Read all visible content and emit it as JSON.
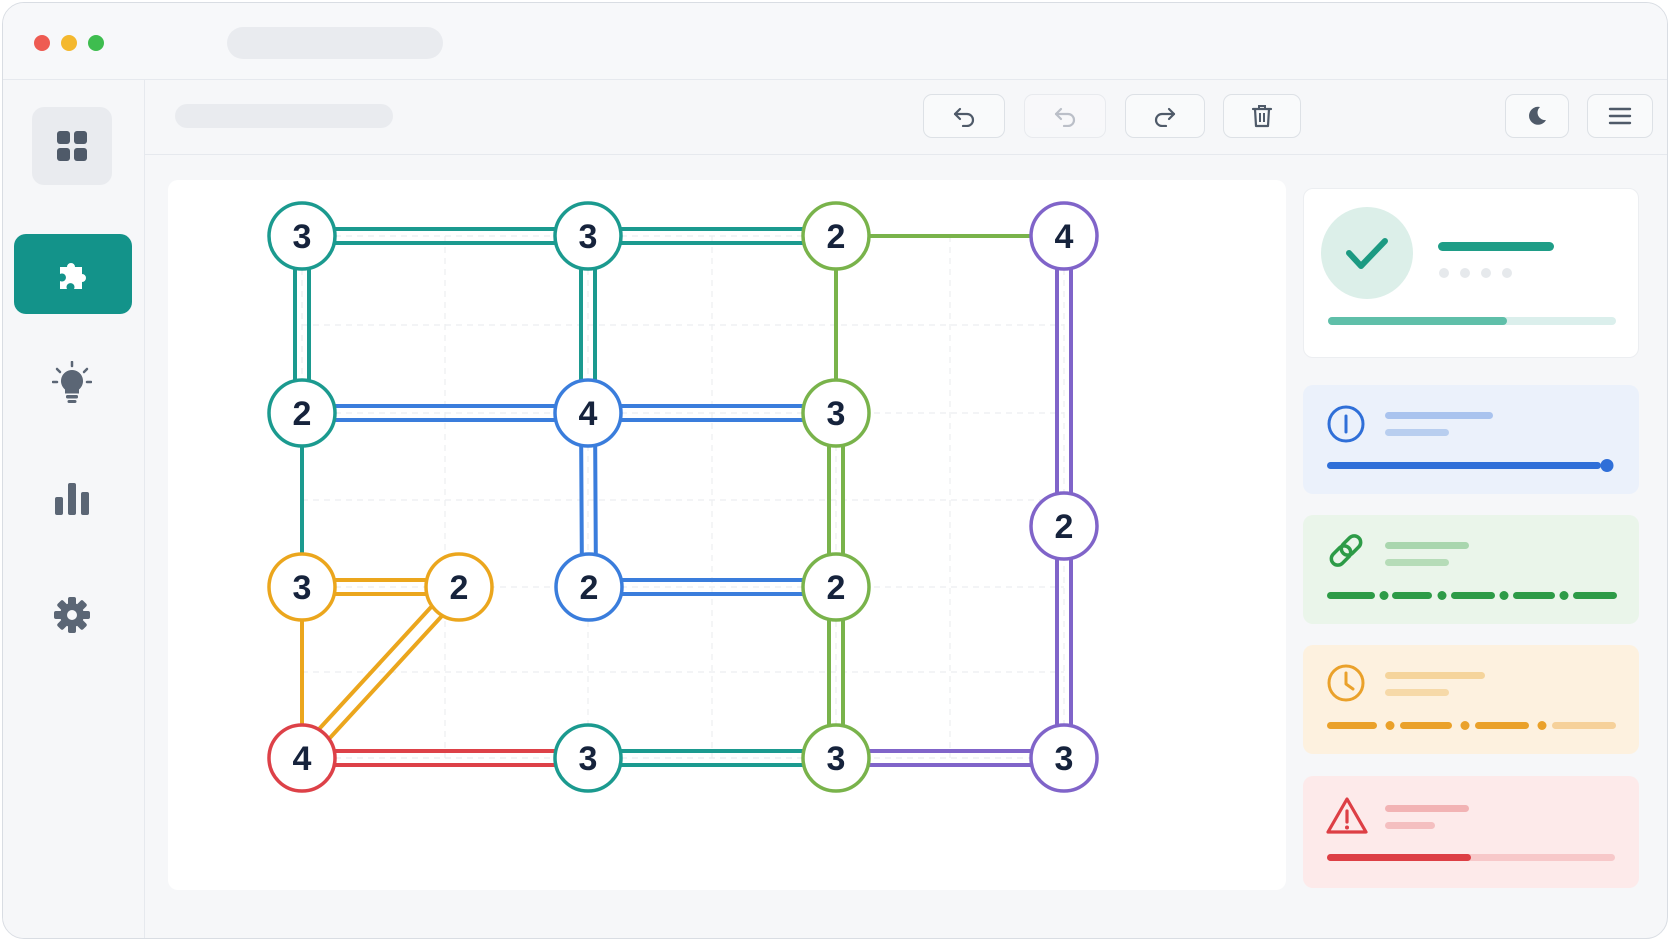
{
  "colors": {
    "accent": "#13938a",
    "teal": "#1b9a8f",
    "green": "#79b34b",
    "purple": "#8064c9",
    "blue": "#3a7ddc",
    "orange": "#eba61d",
    "red": "#dd4148",
    "success": "#2aa084",
    "info": "#2f6fd8",
    "link": "#2d9b47",
    "warning": "#eaa12a",
    "danger": "#dd3f45"
  },
  "sidebar": {
    "items": [
      {
        "name": "dashboard",
        "icon": "grid-icon",
        "active": false
      },
      {
        "name": "puzzle",
        "icon": "puzzle-icon",
        "active": true
      },
      {
        "name": "hints",
        "icon": "lightbulb-icon",
        "active": false
      },
      {
        "name": "stats",
        "icon": "bar-chart-icon",
        "active": false
      },
      {
        "name": "settings",
        "icon": "gear-icon",
        "active": false
      }
    ]
  },
  "toolbar": {
    "buttons": [
      {
        "name": "undo",
        "icon": "undo-icon",
        "enabled": true
      },
      {
        "name": "undo-secondary",
        "icon": "undo-icon",
        "enabled": false
      },
      {
        "name": "redo",
        "icon": "redo-icon",
        "enabled": true
      },
      {
        "name": "delete",
        "icon": "trash-icon",
        "enabled": true
      }
    ],
    "right_buttons": [
      {
        "name": "theme",
        "icon": "moon-icon"
      },
      {
        "name": "menu",
        "icon": "hamburger-icon"
      }
    ]
  },
  "puzzle": {
    "type": "hashi",
    "islands": [
      {
        "id": "r1c1",
        "value": "3",
        "color": "teal"
      },
      {
        "id": "r1c2",
        "value": "3",
        "color": "teal"
      },
      {
        "id": "r1c3",
        "value": "2",
        "color": "green"
      },
      {
        "id": "r1c4",
        "value": "4",
        "color": "purple"
      },
      {
        "id": "r2c1",
        "value": "2",
        "color": "teal"
      },
      {
        "id": "r2c2",
        "value": "4",
        "color": "blue"
      },
      {
        "id": "r2c3",
        "value": "3",
        "color": "green"
      },
      {
        "id": "r2c4",
        "value": "2",
        "color": "purple"
      },
      {
        "id": "r3c1",
        "value": "3",
        "color": "orange"
      },
      {
        "id": "r3c1b",
        "value": "2",
        "color": "orange"
      },
      {
        "id": "r3c2",
        "value": "2",
        "color": "blue"
      },
      {
        "id": "r3c3",
        "value": "2",
        "color": "green"
      },
      {
        "id": "r4c1",
        "value": "4",
        "color": "red"
      },
      {
        "id": "r4c2",
        "value": "3",
        "color": "teal"
      },
      {
        "id": "r4c3",
        "value": "3",
        "color": "green"
      },
      {
        "id": "r4c4",
        "value": "3",
        "color": "purple"
      }
    ],
    "bridges": [
      {
        "from": "r1c1",
        "to": "r1c2",
        "count": 2,
        "color": "teal"
      },
      {
        "from": "r1c2",
        "to": "r1c3",
        "count": 2,
        "color": "teal"
      },
      {
        "from": "r1c3",
        "to": "r1c4",
        "count": 1,
        "color": "green"
      },
      {
        "from": "r1c1",
        "to": "r2c1",
        "count": 2,
        "color": "teal"
      },
      {
        "from": "r1c2",
        "to": "r2c2",
        "count": 2,
        "color": "teal"
      },
      {
        "from": "r1c3",
        "to": "r2c3",
        "count": 1,
        "color": "green"
      },
      {
        "from": "r1c4",
        "to": "r2c4",
        "count": 2,
        "color": "purple"
      },
      {
        "from": "r2c1",
        "to": "r2c2",
        "count": 2,
        "color": "blue"
      },
      {
        "from": "r2c2",
        "to": "r2c3",
        "count": 2,
        "color": "blue"
      },
      {
        "from": "r2c1",
        "to": "r3c1",
        "count": 1,
        "color": "teal"
      },
      {
        "from": "r2c2",
        "to": "r3c2",
        "count": 2,
        "color": "blue"
      },
      {
        "from": "r2c3",
        "to": "r3c3",
        "count": 2,
        "color": "green"
      },
      {
        "from": "r2c4",
        "to": "r4c4",
        "count": 2,
        "color": "purple"
      },
      {
        "from": "r3c1",
        "to": "r3c1b",
        "count": 2,
        "color": "orange"
      },
      {
        "from": "r3c2",
        "to": "r3c3",
        "count": 2,
        "color": "blue"
      },
      {
        "from": "r3c1",
        "to": "r4c1",
        "count": 1,
        "color": "orange"
      },
      {
        "from": "r3c1b",
        "to": "r4c1",
        "count": 2,
        "color": "orange"
      },
      {
        "from": "r3c3",
        "to": "r4c3",
        "count": 2,
        "color": "green"
      },
      {
        "from": "r4c1",
        "to": "r4c2",
        "count": 2,
        "color": "red"
      },
      {
        "from": "r4c2",
        "to": "r4c3",
        "count": 2,
        "color": "teal"
      },
      {
        "from": "r4c3",
        "to": "r4c4",
        "count": 2,
        "color": "purple"
      }
    ]
  },
  "status_panel": {
    "icon": "check-icon",
    "progress": 0.62
  },
  "info_cards": [
    {
      "kind": "info",
      "icon": "info-icon",
      "progress": 1.0
    },
    {
      "kind": "link",
      "icon": "link-icon"
    },
    {
      "kind": "time",
      "icon": "clock-icon"
    },
    {
      "kind": "warning",
      "icon": "warning-icon",
      "progress": 0.5
    }
  ]
}
